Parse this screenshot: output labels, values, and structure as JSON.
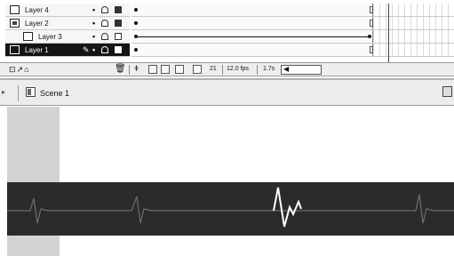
{
  "timeline": {
    "layers": [
      {
        "name": "Layer 4",
        "kind": "guide",
        "selected": false
      },
      {
        "name": "Layer 2",
        "kind": "mask",
        "selected": false
      },
      {
        "name": "Layer 3",
        "kind": "masked",
        "selected": false
      },
      {
        "name": "Layer 1",
        "kind": "normal",
        "selected": true
      }
    ],
    "current_frame": "21",
    "frame_rate": "12.0 fps",
    "elapsed_time": "1.7s"
  },
  "edit_bar": {
    "scene_name": "Scene 1"
  },
  "stage": {
    "strip_color": "#2b2b2b",
    "line_color": "#6e6e6e",
    "highlight_color": "#ffffff"
  },
  "colors": {
    "selected_layer_bg": "#151515",
    "gutter": "#d3d3d3",
    "edit_bar_bg": "#ececec"
  }
}
